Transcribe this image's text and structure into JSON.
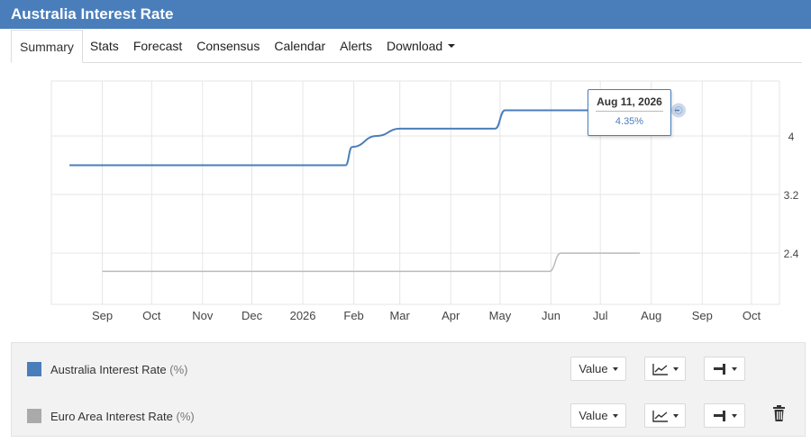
{
  "header": {
    "title": "Australia Interest Rate"
  },
  "tabs": [
    {
      "label": "Summary",
      "active": true
    },
    {
      "label": "Stats"
    },
    {
      "label": "Forecast"
    },
    {
      "label": "Consensus"
    },
    {
      "label": "Calendar"
    },
    {
      "label": "Alerts"
    },
    {
      "label": "Download",
      "dropdown": true
    }
  ],
  "chart_data": {
    "type": "line",
    "x_axis_labels": [
      "Sep",
      "Oct",
      "Nov",
      "Dec",
      "2026",
      "Feb",
      "Mar",
      "Apr",
      "May",
      "Jun",
      "Jul",
      "Aug",
      "Sep",
      "Oct"
    ],
    "y_axis": {
      "ticks": [
        2.4,
        3.2,
        4
      ],
      "position": "right",
      "range": [
        1.7,
        4.75
      ]
    },
    "grid": true,
    "series": [
      {
        "name": "Australia Interest Rate",
        "unit": "%",
        "color": "#4a7ebb",
        "points": [
          {
            "date": "2025-08-12",
            "value": 3.6
          },
          {
            "date": "2026-01-27",
            "value": 3.6
          },
          {
            "date": "2026-01-31",
            "value": 3.85
          },
          {
            "date": "2026-02-15",
            "value": 4.0
          },
          {
            "date": "2026-03-01",
            "value": 4.1
          },
          {
            "date": "2026-03-20",
            "value": 4.1
          },
          {
            "date": "2026-04-28",
            "value": 4.1
          },
          {
            "date": "2026-05-04",
            "value": 4.35
          },
          {
            "date": "2026-08-11",
            "value": 4.35
          }
        ]
      },
      {
        "name": "Euro Area Interest Rate",
        "unit": "%",
        "color": "#bbbbbb",
        "points": [
          {
            "date": "2025-09-01",
            "value": 2.15
          },
          {
            "date": "2026-05-31",
            "value": 2.15
          },
          {
            "date": "2026-06-07",
            "value": 2.4
          },
          {
            "date": "2026-07-25",
            "value": 2.4
          }
        ]
      }
    ],
    "tooltip": {
      "date": "Aug 11, 2026",
      "value": "4.35%"
    }
  },
  "legend": {
    "series": [
      {
        "name": "Australia Interest Rate",
        "unit": "(%)",
        "color": "#4a7ebb",
        "value_label": "Value",
        "deletable": false
      },
      {
        "name": "Euro Area Interest Rate",
        "unit": "(%)",
        "color": "#aaaaaa",
        "value_label": "Value",
        "deletable": true
      }
    ]
  }
}
